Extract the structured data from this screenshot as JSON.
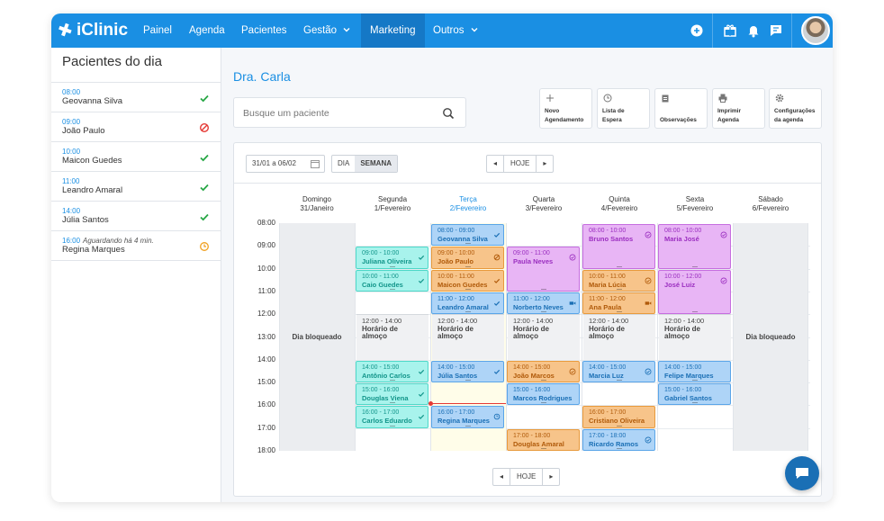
{
  "brand": {
    "name": "iClinic",
    "color": "#1a8fe3"
  },
  "nav": {
    "items": [
      "Painel",
      "Agenda",
      "Pacientes",
      "Gestão",
      "Marketing",
      "Outros"
    ],
    "active": "Marketing",
    "icons": [
      "plus-circle-icon",
      "gift-icon",
      "bell-icon",
      "chat-icon"
    ]
  },
  "sidebar": {
    "title": "Pacientes do dia",
    "items": [
      {
        "time": "08:00",
        "note": "",
        "name": "Geovanna Silva",
        "status": "check"
      },
      {
        "time": "09:00",
        "note": "",
        "name": "João Paulo",
        "status": "cancelled"
      },
      {
        "time": "10:00",
        "note": "",
        "name": "Maicon Guedes",
        "status": "check"
      },
      {
        "time": "11:00",
        "note": "",
        "name": "Leandro Amaral",
        "status": "check"
      },
      {
        "time": "14:00",
        "note": "",
        "name": "Júlia Santos",
        "status": "check"
      },
      {
        "time": "16:00",
        "note": "Aguardando há 4 min.",
        "name": "Regina Marques",
        "status": "waiting"
      }
    ]
  },
  "main": {
    "doctor": "Dra. Carla",
    "search_placeholder": "Busque um paciente",
    "quick_actions": [
      {
        "l1": "Novo",
        "l2": "Agendamento",
        "icon": "plus-icon"
      },
      {
        "l1": "Lista de",
        "l2": "Espera",
        "icon": "clock-icon"
      },
      {
        "l1": "Observações",
        "l2": "",
        "icon": "clipboard-icon"
      },
      {
        "l1": "Imprimir",
        "l2": "Agenda",
        "icon": "printer-icon"
      },
      {
        "l1": "Configurações",
        "l2": "da agenda",
        "icon": "gear-icon"
      }
    ]
  },
  "calendar": {
    "date_range": "31/01 a 06/02",
    "view_day": "DIA",
    "view_week": "SEMANA",
    "today_label": "HOJE",
    "days": [
      {
        "name": "Domingo",
        "date": "31/Janeiro",
        "blocked": true
      },
      {
        "name": "Segunda",
        "date": "1/Fevereiro",
        "blocked": false
      },
      {
        "name": "Terça",
        "date": "2/Fevereiro",
        "blocked": false,
        "today": true
      },
      {
        "name": "Quarta",
        "date": "3/Fevereiro",
        "blocked": false
      },
      {
        "name": "Quinta",
        "date": "4/Fevereiro",
        "blocked": false
      },
      {
        "name": "Sexta",
        "date": "5/Fevereiro",
        "blocked": false
      },
      {
        "name": "Sábado",
        "date": "6/Fevereiro",
        "blocked": true
      }
    ],
    "hours": [
      "08:00",
      "09:00",
      "10:00",
      "11:00",
      "12:00",
      "13:00",
      "14:00",
      "15:00",
      "16:00",
      "17:00",
      "18:00"
    ],
    "blocked_label": "Dia bloqueado",
    "lunch": {
      "time": "12:00 - 14:00",
      "label": "Horário de almoço",
      "line1": "Horário de",
      "line2": "almoço"
    },
    "now_hour": 15.9,
    "palette": {
      "teal": {
        "bg": "#a8f3ec",
        "border": "#4dd8c8",
        "text": "#12958a"
      },
      "blue": {
        "bg": "#aed4f7",
        "border": "#5aa5e8",
        "text": "#1a6fb5"
      },
      "orange": {
        "bg": "#f7c48a",
        "border": "#e89a3c",
        "text": "#b05a0a"
      },
      "purple": {
        "bg": "#e8b5f5",
        "border": "#c66ddf",
        "text": "#9b2fc0"
      }
    },
    "appointments": [
      {
        "day": 1,
        "start": 9,
        "end": 10,
        "time": "09:00 - 10:00",
        "name": "Juliana Oliveira",
        "color": "teal",
        "icon": "check"
      },
      {
        "day": 1,
        "start": 10,
        "end": 11,
        "time": "10:00 - 11:00",
        "name": "Caio Guedes",
        "color": "teal",
        "icon": "check"
      },
      {
        "day": 1,
        "start": 14,
        "end": 15,
        "time": "14:00 - 15:00",
        "name": "Antônio Carlos",
        "color": "teal",
        "icon": "check"
      },
      {
        "day": 1,
        "start": 15,
        "end": 16,
        "time": "15:00 - 16:00",
        "name": "Douglas Viena",
        "color": "teal",
        "icon": "check"
      },
      {
        "day": 1,
        "start": 16,
        "end": 17,
        "time": "16:00 - 17:00",
        "name": "Carlos Eduardo",
        "color": "teal",
        "icon": "check"
      },
      {
        "day": 2,
        "start": 8,
        "end": 9,
        "time": "08:00 - 09:00",
        "name": "Geovanna Silva",
        "color": "blue",
        "icon": "check"
      },
      {
        "day": 2,
        "start": 9,
        "end": 10,
        "time": "09:00 - 10:00",
        "name": "João Paulo",
        "color": "orange",
        "icon": "cancelled"
      },
      {
        "day": 2,
        "start": 10,
        "end": 11,
        "time": "10:00 - 11:00",
        "name": "Maicon Guedes",
        "color": "orange",
        "icon": "check"
      },
      {
        "day": 2,
        "start": 11,
        "end": 12,
        "time": "11:00 - 12:00",
        "name": "Leandro Amaral",
        "color": "blue",
        "icon": "check"
      },
      {
        "day": 2,
        "start": 14,
        "end": 15,
        "time": "14:00 - 15:00",
        "name": "Júlia Santos",
        "color": "blue",
        "icon": "check"
      },
      {
        "day": 2,
        "start": 16,
        "end": 17,
        "time": "16:00 - 17:00",
        "name": "Regina Marques",
        "color": "blue",
        "icon": "clock"
      },
      {
        "day": 3,
        "start": 9,
        "end": 11,
        "time": "09:00 - 11:00",
        "name": "Paula Neves",
        "color": "purple",
        "icon": "circle-check"
      },
      {
        "day": 3,
        "start": 11,
        "end": 12,
        "time": "11:00 - 12:00",
        "name": "Norberto Neves",
        "color": "blue",
        "icon": "video"
      },
      {
        "day": 3,
        "start": 14,
        "end": 15,
        "time": "14:00 - 15:00",
        "name": "João Marcos",
        "color": "orange",
        "icon": "circle-check"
      },
      {
        "day": 3,
        "start": 15,
        "end": 16,
        "time": "15:00 - 16:00",
        "name": "Marcos Rodrigues",
        "color": "blue",
        "icon": ""
      },
      {
        "day": 3,
        "start": 17,
        "end": 18,
        "time": "17:00 - 18:00",
        "name": "Douglas Amaral",
        "color": "orange",
        "icon": ""
      },
      {
        "day": 4,
        "start": 8,
        "end": 10,
        "time": "08:00 - 10:00",
        "name": "Bruno Santos",
        "color": "purple",
        "icon": "circle-check"
      },
      {
        "day": 4,
        "start": 10,
        "end": 11,
        "time": "10:00 - 11:00",
        "name": "Maria Lúcia",
        "color": "orange",
        "icon": "circle-check"
      },
      {
        "day": 4,
        "start": 11,
        "end": 12,
        "time": "11:00 - 12:00",
        "name": "Ana Paula",
        "color": "orange",
        "icon": "video"
      },
      {
        "day": 4,
        "start": 14,
        "end": 15,
        "time": "14:00 - 15:00",
        "name": "Marcia Luz",
        "color": "blue",
        "icon": "circle-check"
      },
      {
        "day": 4,
        "start": 16,
        "end": 17,
        "time": "16:00 - 17:00",
        "name": "Cristiano Oliveira",
        "color": "orange",
        "icon": ""
      },
      {
        "day": 4,
        "start": 17,
        "end": 18,
        "time": "17:00 - 18:00",
        "name": "Ricardo Ramos",
        "color": "blue",
        "icon": "circle-check"
      },
      {
        "day": 5,
        "start": 8,
        "end": 10,
        "time": "08:00 - 10:00",
        "name": "Maria José",
        "color": "purple",
        "icon": "circle-check"
      },
      {
        "day": 5,
        "start": 10,
        "end": 12,
        "time": "10:00 - 12:00",
        "name": "José Luiz",
        "color": "purple",
        "icon": "circle-check"
      },
      {
        "day": 5,
        "start": 14,
        "end": 15,
        "time": "14:00 - 15:00",
        "name": "Felipe Marques",
        "color": "blue",
        "icon": ""
      },
      {
        "day": 5,
        "start": 15,
        "end": 16,
        "time": "15:00 - 16:00",
        "name": "Gabriel Santos",
        "color": "blue",
        "icon": ""
      }
    ]
  }
}
